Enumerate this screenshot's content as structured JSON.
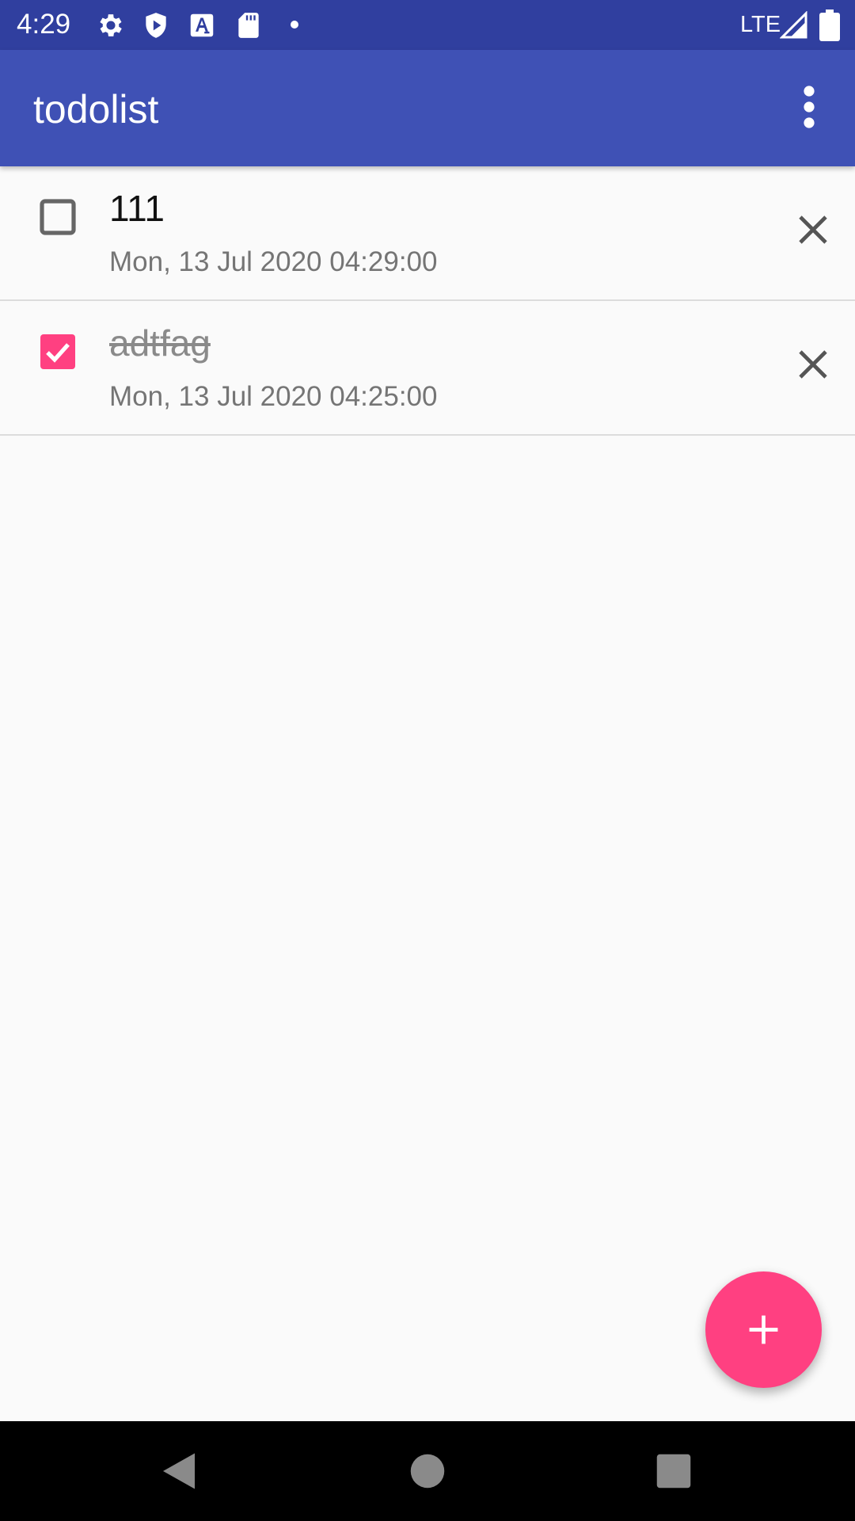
{
  "status_bar": {
    "time": "4:29",
    "network": "LTE",
    "icons": [
      "settings-icon",
      "shield-play-icon",
      "font-a-icon",
      "sd-card-icon",
      "dot-icon",
      "signal-icon",
      "battery-icon"
    ]
  },
  "app_bar": {
    "title": "todolist",
    "menu_icon": "more-vert-icon"
  },
  "todos": [
    {
      "title": "111",
      "date": "Mon, 13 Jul 2020 04:29:00",
      "checked": false
    },
    {
      "title": "adtfag",
      "date": "Mon, 13 Jul 2020 04:25:00",
      "checked": true
    }
  ],
  "fab": {
    "icon": "add-icon"
  },
  "nav_bar": {
    "icons": [
      "back-icon",
      "home-icon",
      "recents-icon"
    ]
  },
  "colors": {
    "status_bar": "#303f9f",
    "app_bar": "#3f51b5",
    "accent": "#ff4081",
    "background": "#fafafa"
  }
}
